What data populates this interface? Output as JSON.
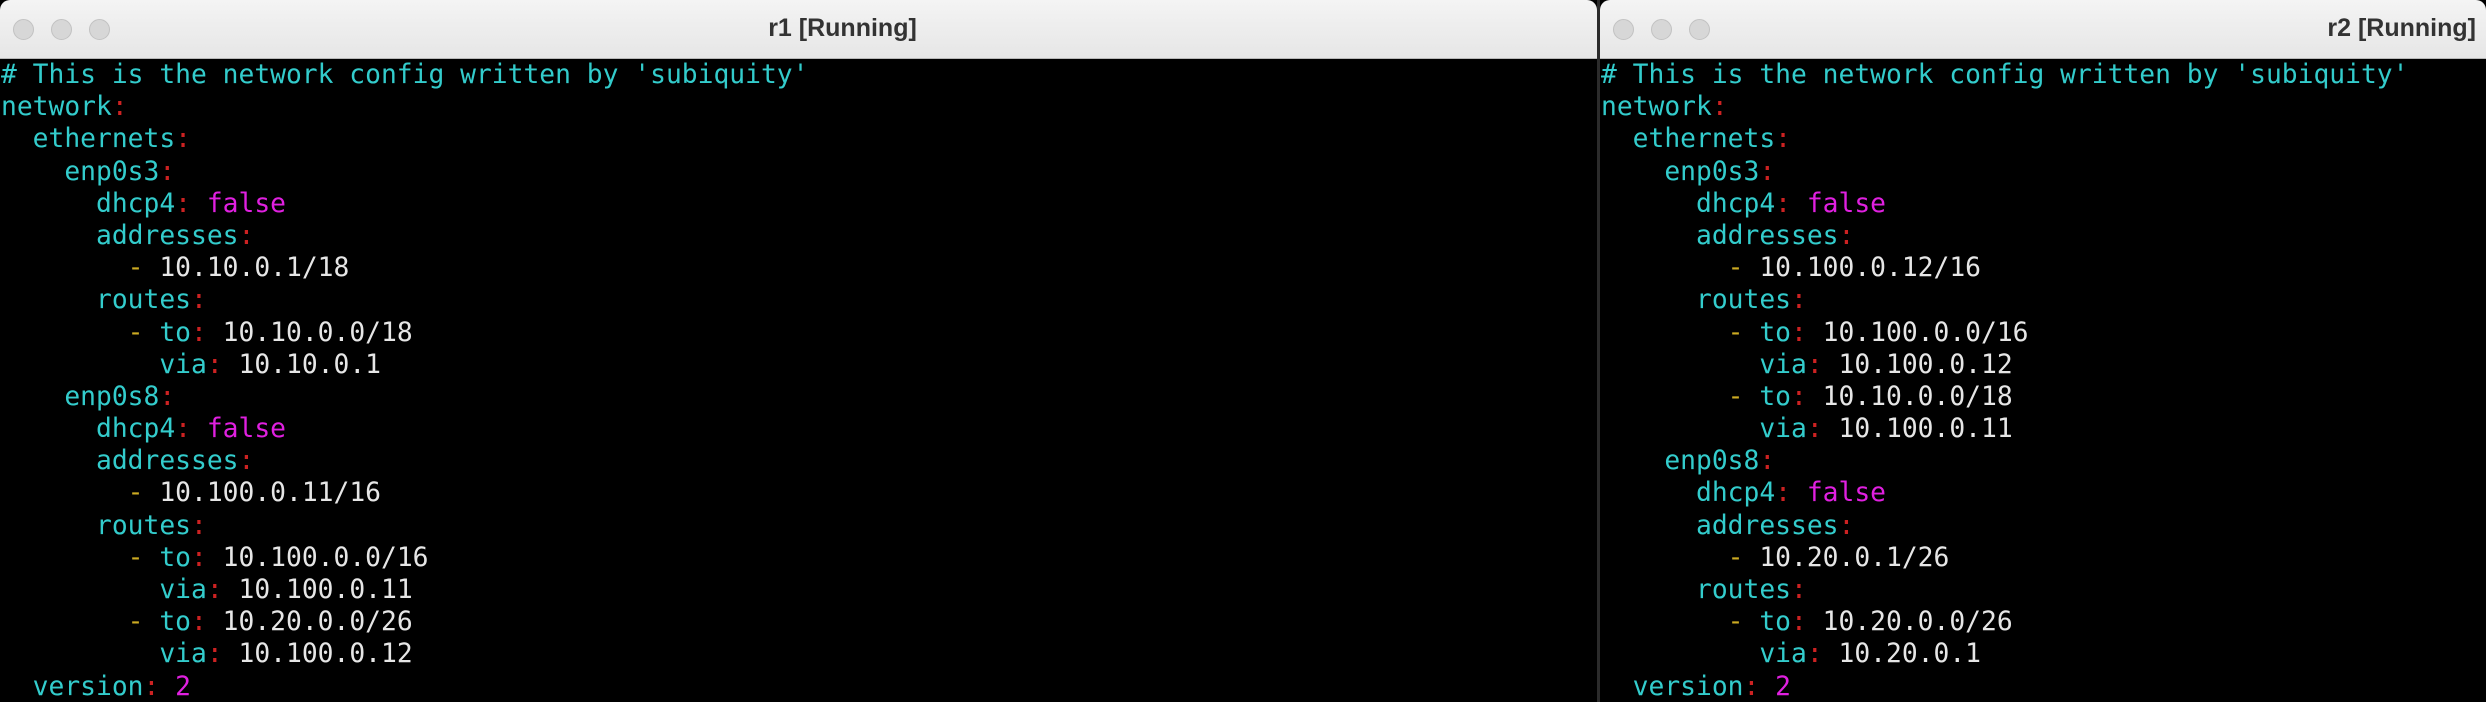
{
  "windows": {
    "r1": {
      "title": "r1 [Running]",
      "lines": [
        [
          {
            "t": "# This is the network config written by 'subiquity'",
            "c": "c"
          }
        ],
        [
          {
            "t": "network",
            "c": "k"
          },
          {
            "t": ":",
            "c": "p"
          }
        ],
        [
          {
            "t": "  ethernets",
            "c": "k"
          },
          {
            "t": ":",
            "c": "p"
          }
        ],
        [
          {
            "t": "    enp0s3",
            "c": "k"
          },
          {
            "t": ":",
            "c": "p"
          }
        ],
        [
          {
            "t": "      dhcp4",
            "c": "k"
          },
          {
            "t": ": ",
            "c": "p"
          },
          {
            "t": "false",
            "c": "m"
          }
        ],
        [
          {
            "t": "      addresses",
            "c": "k"
          },
          {
            "t": ":",
            "c": "p"
          }
        ],
        [
          {
            "t": "        - ",
            "c": "d"
          },
          {
            "t": "10.10.0.1/18",
            "c": "v"
          }
        ],
        [
          {
            "t": "      routes",
            "c": "k"
          },
          {
            "t": ":",
            "c": "p"
          }
        ],
        [
          {
            "t": "        - ",
            "c": "d"
          },
          {
            "t": "to",
            "c": "k"
          },
          {
            "t": ": ",
            "c": "p"
          },
          {
            "t": "10.10.0.0/18",
            "c": "v"
          }
        ],
        [
          {
            "t": "          via",
            "c": "k"
          },
          {
            "t": ": ",
            "c": "p"
          },
          {
            "t": "10.10.0.1",
            "c": "v"
          }
        ],
        [
          {
            "t": "    enp0s8",
            "c": "k"
          },
          {
            "t": ":",
            "c": "p"
          }
        ],
        [
          {
            "t": "      dhcp4",
            "c": "k"
          },
          {
            "t": ": ",
            "c": "p"
          },
          {
            "t": "false",
            "c": "m"
          }
        ],
        [
          {
            "t": "      addresses",
            "c": "k"
          },
          {
            "t": ":",
            "c": "p"
          }
        ],
        [
          {
            "t": "        - ",
            "c": "d"
          },
          {
            "t": "10.100.0.11/16",
            "c": "v"
          }
        ],
        [
          {
            "t": "      routes",
            "c": "k"
          },
          {
            "t": ":",
            "c": "p"
          }
        ],
        [
          {
            "t": "        - ",
            "c": "d"
          },
          {
            "t": "to",
            "c": "k"
          },
          {
            "t": ": ",
            "c": "p"
          },
          {
            "t": "10.100.0.0/16",
            "c": "v"
          }
        ],
        [
          {
            "t": "          via",
            "c": "k"
          },
          {
            "t": ": ",
            "c": "p"
          },
          {
            "t": "10.100.0.11",
            "c": "v"
          }
        ],
        [
          {
            "t": "        - ",
            "c": "d"
          },
          {
            "t": "to",
            "c": "k"
          },
          {
            "t": ": ",
            "c": "p"
          },
          {
            "t": "10.20.0.0/26",
            "c": "v"
          }
        ],
        [
          {
            "t": "          via",
            "c": "k"
          },
          {
            "t": ": ",
            "c": "p"
          },
          {
            "t": "10.100.0.12",
            "c": "v"
          }
        ],
        [
          {
            "t": "  version",
            "c": "k"
          },
          {
            "t": ": ",
            "c": "p"
          },
          {
            "t": "2",
            "c": "m"
          }
        ]
      ]
    },
    "r2": {
      "title": "r2 [Running]",
      "lines": [
        [
          {
            "t": "# This is the network config written by 'subiquity'",
            "c": "c"
          }
        ],
        [
          {
            "t": "network",
            "c": "k"
          },
          {
            "t": ":",
            "c": "p"
          }
        ],
        [
          {
            "t": "  ethernets",
            "c": "k"
          },
          {
            "t": ":",
            "c": "p"
          }
        ],
        [
          {
            "t": "    enp0s3",
            "c": "k"
          },
          {
            "t": ":",
            "c": "p"
          }
        ],
        [
          {
            "t": "      dhcp4",
            "c": "k"
          },
          {
            "t": ": ",
            "c": "p"
          },
          {
            "t": "false",
            "c": "m"
          }
        ],
        [
          {
            "t": "      addresses",
            "c": "k"
          },
          {
            "t": ":",
            "c": "p"
          }
        ],
        [
          {
            "t": "        - ",
            "c": "d"
          },
          {
            "t": "10.100.0.12/16",
            "c": "v"
          }
        ],
        [
          {
            "t": "      routes",
            "c": "k"
          },
          {
            "t": ":",
            "c": "p"
          }
        ],
        [
          {
            "t": "        - ",
            "c": "d"
          },
          {
            "t": "to",
            "c": "k"
          },
          {
            "t": ": ",
            "c": "p"
          },
          {
            "t": "10.100.0.0/16",
            "c": "v"
          }
        ],
        [
          {
            "t": "          via",
            "c": "k"
          },
          {
            "t": ": ",
            "c": "p"
          },
          {
            "t": "10.100.0.12",
            "c": "v"
          }
        ],
        [
          {
            "t": "        - ",
            "c": "d"
          },
          {
            "t": "to",
            "c": "k"
          },
          {
            "t": ": ",
            "c": "p"
          },
          {
            "t": "10.10.0.0/18",
            "c": "v"
          }
        ],
        [
          {
            "t": "          via",
            "c": "k"
          },
          {
            "t": ": ",
            "c": "p"
          },
          {
            "t": "10.100.0.11",
            "c": "v"
          }
        ],
        [
          {
            "t": "    enp0s8",
            "c": "k"
          },
          {
            "t": ":",
            "c": "p"
          }
        ],
        [
          {
            "t": "      dhcp4",
            "c": "k"
          },
          {
            "t": ": ",
            "c": "p"
          },
          {
            "t": "false",
            "c": "m"
          }
        ],
        [
          {
            "t": "      addresses",
            "c": "k"
          },
          {
            "t": ":",
            "c": "p"
          }
        ],
        [
          {
            "t": "        - ",
            "c": "d"
          },
          {
            "t": "10.20.0.1/26",
            "c": "v"
          }
        ],
        [
          {
            "t": "      routes",
            "c": "k"
          },
          {
            "t": ":",
            "c": "p"
          }
        ],
        [
          {
            "t": "        - ",
            "c": "d"
          },
          {
            "t": "to",
            "c": "k"
          },
          {
            "t": ": ",
            "c": "p"
          },
          {
            "t": "10.20.0.0/26",
            "c": "v"
          }
        ],
        [
          {
            "t": "          via",
            "c": "k"
          },
          {
            "t": ": ",
            "c": "p"
          },
          {
            "t": "10.20.0.1",
            "c": "v"
          }
        ],
        [
          {
            "t": "  version",
            "c": "k"
          },
          {
            "t": ": ",
            "c": "p"
          },
          {
            "t": "2",
            "c": "m"
          }
        ]
      ]
    }
  }
}
